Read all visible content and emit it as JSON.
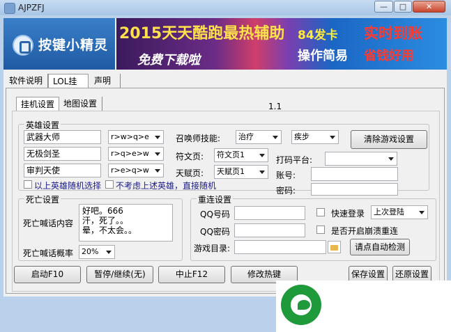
{
  "window": {
    "title": "AJPZFJ",
    "min_icon": "minimize-icon",
    "max_icon": "maximize-icon",
    "close_icon": "close-icon"
  },
  "logo": {
    "text": "按键小精灵",
    "icon": "app-logo-icon"
  },
  "banner": {
    "line1": "2015天天酷跑最热辅助",
    "line2": "免费下载啦",
    "line3": "84发卡",
    "line4": "实时到账",
    "line5": "操作简易",
    "line6": "省钱好用"
  },
  "main_tabs": [
    "软件说明",
    "LOL挂机",
    "声明"
  ],
  "sub_tabs": [
    "挂机设置",
    "地图设置"
  ],
  "version": "1.1",
  "hero": {
    "group_title": "英雄设置",
    "heroes": [
      {
        "name": "武器大师",
        "combo": "r>w>q>e"
      },
      {
        "name": "无极剑圣",
        "combo": "r>q>e>w"
      },
      {
        "name": "审判天使",
        "combo": "r>e>q>w"
      }
    ],
    "random_check_label": "以上英雄随机选择",
    "skip_check_label": "不考虑上述英雄，直接随机"
  },
  "summoner": {
    "label": "召唤师技能:",
    "spell1": "治疗",
    "spell2": "疾步",
    "rune_label": "符文页:",
    "rune_value": "符文页1",
    "talent_label": "天赋页:",
    "talent_value": "天赋页1",
    "clear_button": "清除游戏设置"
  },
  "captcha": {
    "platform_label": "打码平台:",
    "platform_value": "",
    "account_label": "账号:",
    "account_value": "",
    "password_label": "密码:",
    "password_value": ""
  },
  "death": {
    "group_title": "死亡设置",
    "message_label": "死亡喊话内容",
    "message_text": "好吧。666\n汗，死了。。\n晕，不太会。。",
    "prob_label": "死亡喊话概率",
    "prob_value": "20%"
  },
  "reconnect": {
    "group_title": "重连设置",
    "qq_label": "QQ号码",
    "qq_value": "",
    "pwd_label": "QQ密码",
    "pwd_value": "",
    "fast_login_label": "快速登录",
    "fast_login_value": "上次登陆",
    "crash_label": "是否开启崩溃重连",
    "dir_label": "游戏目录:",
    "dir_value": "",
    "detect_button": "请点自动检测"
  },
  "buttons": {
    "start": "启动F10",
    "pause": "暂停/继续(无)",
    "stop": "中止F12",
    "hotkey": "修改热键",
    "save": "保存设置",
    "restore": "还原设置"
  },
  "overlay_icon": "leaf-logo-icon"
}
